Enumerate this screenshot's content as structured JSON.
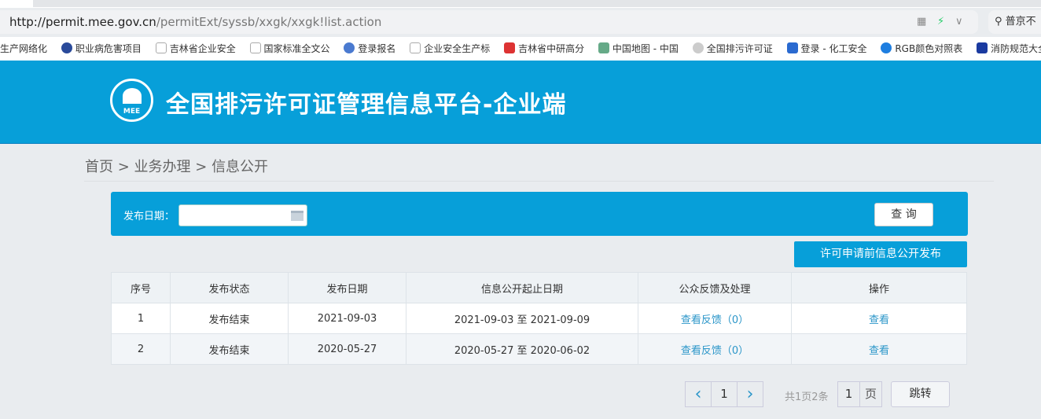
{
  "browser": {
    "url_host": "http://permit.mee.gov.cn",
    "url_path": "/permitExt/syssb/xxgk/xxgk!list.action",
    "search_text": "普京不",
    "bookmarks": [
      "生产网络化",
      "职业病危害项目",
      "吉林省企业安全",
      "国家标准全文公",
      "登录报名",
      "企业安全生产标",
      "吉林省中研高分",
      "中国地图 - 中国",
      "全国排污许可证",
      "登录 - 化工安全",
      "RGB颜色对照表",
      "消防规范大全 -"
    ]
  },
  "header": {
    "logo_text": "MEE",
    "title": "全国排污许可证管理信息平台-企业端"
  },
  "breadcrumb": {
    "items": [
      "首页",
      "业务办理",
      "信息公开"
    ],
    "sep": " > "
  },
  "search": {
    "date_label": "发布日期：",
    "date_value": "",
    "query_button": "查 询"
  },
  "publish_button": "许可申请前信息公开发布",
  "table": {
    "headers": [
      "序号",
      "发布状态",
      "发布日期",
      "信息公开起止日期",
      "公众反馈及处理",
      "操作"
    ],
    "rows": [
      {
        "no": "1",
        "status": "发布结束",
        "date": "2021-09-03",
        "range": "2021-09-03 至 2021-09-09",
        "feedback": "查看反馈（0）",
        "action": "查看"
      },
      {
        "no": "2",
        "status": "发布结束",
        "date": "2020-05-27",
        "range": "2020-05-27 至 2020-06-02",
        "feedback": "查看反馈（0）",
        "action": "查看"
      }
    ]
  },
  "pagination": {
    "prev": "‹",
    "current": "1",
    "next": "›",
    "summary": "共1页2条",
    "page_input": "1",
    "page_unit": "页",
    "jump": "跳转"
  },
  "colors": {
    "brand": "#079fd9",
    "link": "#2b96c9",
    "background": "#e9ecef"
  }
}
